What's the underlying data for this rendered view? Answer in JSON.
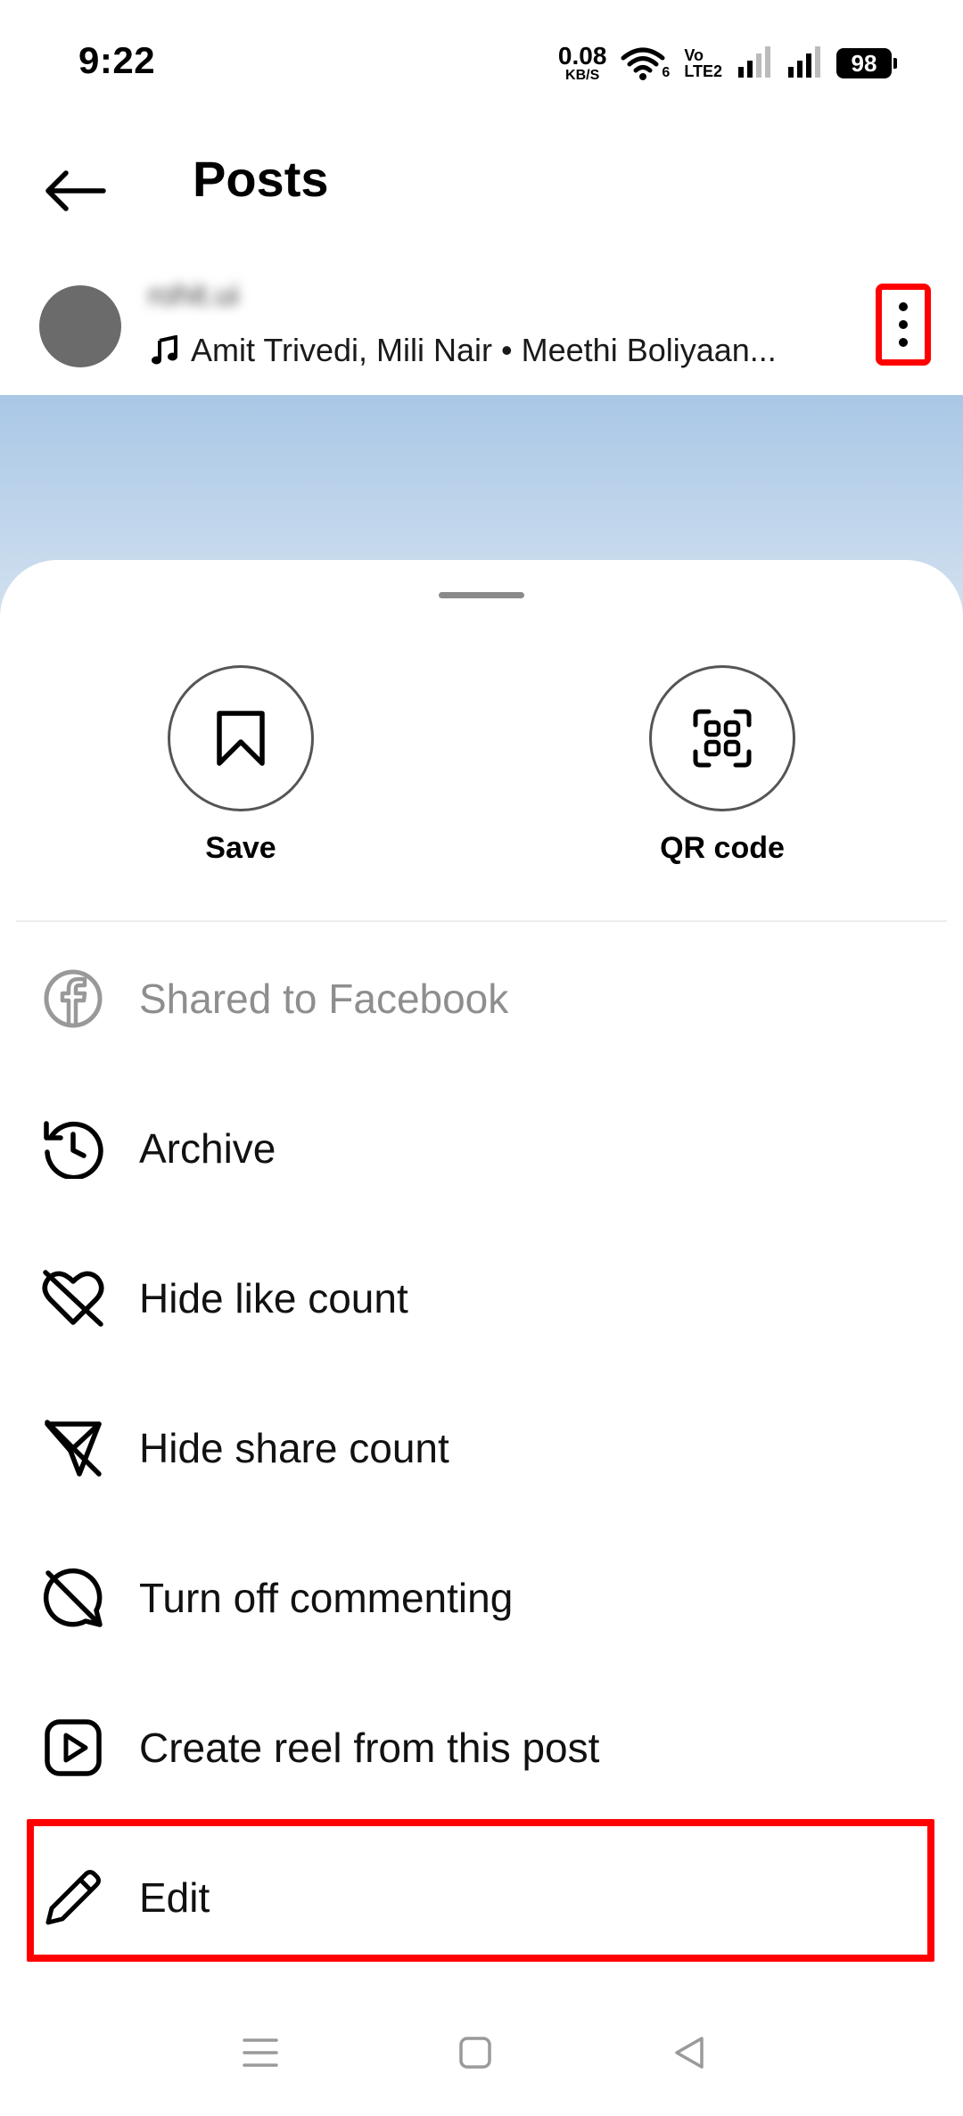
{
  "status_bar": {
    "time": "9:22",
    "net_speed_value": "0.08",
    "net_speed_unit": "KB/S",
    "volte_top": "Vo",
    "volte_bottom": "LTE2",
    "wifi_badge": "6",
    "battery": "98"
  },
  "header": {
    "title": "Posts",
    "back_icon": "arrow-left-icon"
  },
  "post": {
    "username": "rohit.ui",
    "audio": "Amit Trivedi, Mili Nair • Meethi Boliyaan...",
    "more_icon": "more-vertical-icon"
  },
  "sheet": {
    "quick_actions": [
      {
        "label": "Save",
        "icon": "bookmark-icon"
      },
      {
        "label": "QR code",
        "icon": "qr-code-icon"
      }
    ],
    "menu": [
      {
        "label": "Shared to Facebook",
        "icon": "facebook-icon",
        "disabled": true
      },
      {
        "label": "Archive",
        "icon": "archive-history-icon"
      },
      {
        "label": "Hide like count",
        "icon": "heart-off-icon"
      },
      {
        "label": "Hide share count",
        "icon": "share-off-icon"
      },
      {
        "label": "Turn off commenting",
        "icon": "comment-off-icon"
      },
      {
        "label": "Create reel from this post",
        "icon": "reel-play-icon"
      },
      {
        "label": "Edit",
        "icon": "pencil-icon"
      }
    ]
  },
  "colors": {
    "highlight": "#ff0000",
    "disabled_text": "#8e8e8e"
  }
}
